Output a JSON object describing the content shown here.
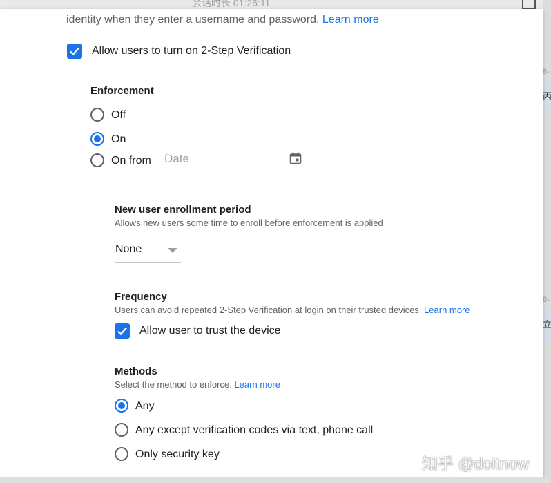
{
  "background": {
    "session_timer": "会话时长 01:26:11",
    "side_tab_1": "丙",
    "side_tab_2": "立",
    "side_dash": "8-",
    "watermark": "知乎 @doitnow"
  },
  "intro": {
    "text": "identity when they enter a username and password.",
    "learn_more": "Learn more"
  },
  "allow_2sv": {
    "label": "Allow users to turn on 2-Step Verification",
    "checked": true
  },
  "enforcement": {
    "heading": "Enforcement",
    "options": [
      {
        "label": "Off",
        "selected": false
      },
      {
        "label": "On",
        "selected": true
      },
      {
        "label": "On from",
        "selected": false
      }
    ],
    "date_placeholder": "Date",
    "calendar_icon": "calendar-icon"
  },
  "enrollment": {
    "heading": "New user enrollment period",
    "description": "Allows new users some time to enroll before enforcement is applied",
    "selected": "None"
  },
  "frequency": {
    "heading": "Frequency",
    "description": "Users can avoid repeated 2-Step Verification at login on their trusted devices.",
    "learn_more": "Learn more",
    "trust_label": "Allow user to trust the device",
    "trust_checked": true
  },
  "methods": {
    "heading": "Methods",
    "description": "Select the method to enforce.",
    "learn_more": "Learn more",
    "options": [
      {
        "label": "Any",
        "selected": true
      },
      {
        "label": "Any except verification codes via text, phone call",
        "selected": false
      },
      {
        "label": "Only security key",
        "selected": false
      }
    ]
  },
  "colors": {
    "accent": "#1a73e8",
    "text": "#202124",
    "secondary": "#5f6368"
  }
}
